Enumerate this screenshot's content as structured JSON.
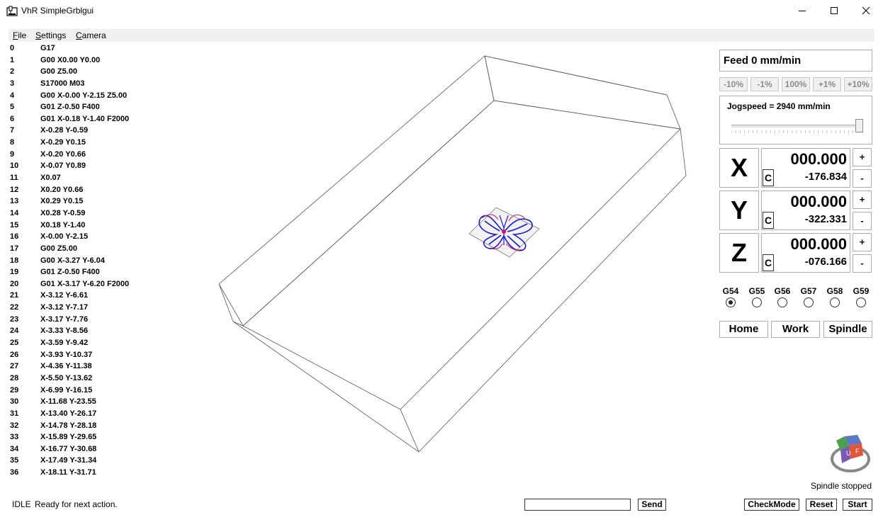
{
  "window": {
    "title": "VhR SimpleGrblgui",
    "icon": "app-icon"
  },
  "menu": [
    {
      "label": "File",
      "key": "F"
    },
    {
      "label": "Settings",
      "key": "S"
    },
    {
      "label": "Camera",
      "key": "C"
    }
  ],
  "gcode_lines": [
    {
      "num": "0",
      "code": "G17"
    },
    {
      "num": "1",
      "code": "G00  X0.00 Y0.00"
    },
    {
      "num": "2",
      "code": "G00  Z5.00"
    },
    {
      "num": "3",
      "code": "S17000 M03"
    },
    {
      "num": "4",
      "code": "G00  X-0.00 Y-2.15 Z5.00"
    },
    {
      "num": "5",
      "code": "G01  Z-0.50 F400"
    },
    {
      "num": "6",
      "code": "G01  X-0.18 Y-1.40 F2000"
    },
    {
      "num": "7",
      "code": "X-0.28 Y-0.59"
    },
    {
      "num": "8",
      "code": "X-0.29 Y0.15"
    },
    {
      "num": "9",
      "code": "X-0.20 Y0.66"
    },
    {
      "num": "10",
      "code": "X-0.07 Y0.89"
    },
    {
      "num": "11",
      "code": "X0.07"
    },
    {
      "num": "12",
      "code": "X0.20 Y0.66"
    },
    {
      "num": "13",
      "code": "X0.29 Y0.15"
    },
    {
      "num": "14",
      "code": "X0.28 Y-0.59"
    },
    {
      "num": "15",
      "code": "X0.18 Y-1.40"
    },
    {
      "num": "16",
      "code": "X-0.00 Y-2.15"
    },
    {
      "num": "17",
      "code": "G00  Z5.00"
    },
    {
      "num": "18",
      "code": "G00  X-3.27 Y-6.04"
    },
    {
      "num": "19",
      "code": "G01  Z-0.50 F400"
    },
    {
      "num": "20",
      "code": "G01  X-3.17 Y-6.20 F2000"
    },
    {
      "num": "21",
      "code": "X-3.12 Y-6.61"
    },
    {
      "num": "22",
      "code": "X-3.12 Y-7.17"
    },
    {
      "num": "23",
      "code": "X-3.17 Y-7.76"
    },
    {
      "num": "24",
      "code": "X-3.33 Y-8.56"
    },
    {
      "num": "25",
      "code": "X-3.59 Y-9.42"
    },
    {
      "num": "26",
      "code": "X-3.93 Y-10.37"
    },
    {
      "num": "27",
      "code": "X-4.36 Y-11.38"
    },
    {
      "num": "28",
      "code": "X-5.50 Y-13.62"
    },
    {
      "num": "29",
      "code": "X-6.99 Y-16.15"
    },
    {
      "num": "30",
      "code": "X-11.68 Y-23.55"
    },
    {
      "num": "31",
      "code": "X-13.40 Y-26.17"
    },
    {
      "num": "32",
      "code": "X-14.78 Y-28.18"
    },
    {
      "num": "33",
      "code": "X-15.89 Y-29.65"
    },
    {
      "num": "34",
      "code": "X-16.77 Y-30.68"
    },
    {
      "num": "35",
      "code": "X-17.49 Y-31.34"
    },
    {
      "num": "36",
      "code": "X-18.11 Y-31.71"
    }
  ],
  "feed": {
    "label": "Feed 0 mm/min"
  },
  "override_buttons": [
    "-10%",
    "-1%",
    "100%",
    "+1%",
    "+10%"
  ],
  "jog": {
    "label": "Jogspeed = 2940 mm/min",
    "level": 0.98
  },
  "axes": [
    {
      "letter": "X",
      "work": "000.000",
      "machine": "-176.834",
      "c": "C",
      "plus": "+",
      "minus": "-"
    },
    {
      "letter": "Y",
      "work": "000.000",
      "machine": "-322.331",
      "c": "C",
      "plus": "+",
      "minus": "-"
    },
    {
      "letter": "Z",
      "work": "000.000",
      "machine": "-076.166",
      "c": "C",
      "plus": "+",
      "minus": "-"
    }
  ],
  "coord_systems": {
    "options": [
      "G54",
      "G55",
      "G56",
      "G57",
      "G58",
      "G59"
    ],
    "selected": "G54"
  },
  "action_buttons": {
    "home": "Home",
    "work": "Work",
    "spindle": "Spindle"
  },
  "spindle_status": "Spindle stopped",
  "status": {
    "state": "IDLE",
    "message": "Ready for next action."
  },
  "command": {
    "value": "",
    "send": "Send"
  },
  "bottom_buttons": {
    "checkmode": "CheckMode",
    "reset": "Reset",
    "start": "Start"
  },
  "colors": {
    "toolpath": "#1a1acc",
    "toolpath_alt": "#d01a5a",
    "menubar": "#f0f0f0",
    "border": "#adadad"
  }
}
